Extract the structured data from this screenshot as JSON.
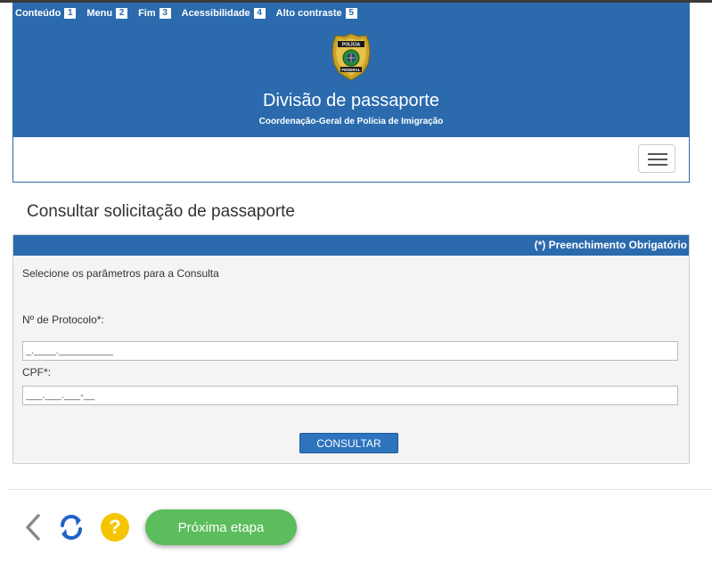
{
  "accessibility_bar": [
    {
      "label": "Conteúdo",
      "key": "1"
    },
    {
      "label": "Menu",
      "key": "2"
    },
    {
      "label": "Fim",
      "key": "3"
    },
    {
      "label": "Acessibilidade",
      "key": "4"
    },
    {
      "label": "Alto contraste",
      "key": "5"
    }
  ],
  "header": {
    "title": "Divisão de passaporte",
    "subtitle": "Coordenação-Geral de Polícia de Imigração",
    "badge_text_top": "POLÍCIA",
    "badge_text_bottom": "FEDERAL"
  },
  "navbar": {
    "menu_icon": "hamburger-icon"
  },
  "page": {
    "title": "Consultar solicitação de passaporte"
  },
  "form": {
    "required_note": "(*) Preenchimento Obrigatório",
    "intro": "Selecione os parâmetros para a Consulta",
    "protocol_label": "Nº de Protocolo*:",
    "protocol_mask": "_.____.__________",
    "cpf_label": "CPF*:",
    "cpf_mask": "___.___.___-__",
    "submit_label": "CONSULTAR"
  },
  "footer": {
    "back_icon": "chevron-left-icon",
    "refresh_icon": "refresh-icon",
    "help_label": "?",
    "next_label": "Próxima etapa"
  },
  "colors": {
    "primary_blue": "#2a6aad",
    "help_yellow": "#f5c400",
    "next_green": "#5bbd5b"
  }
}
